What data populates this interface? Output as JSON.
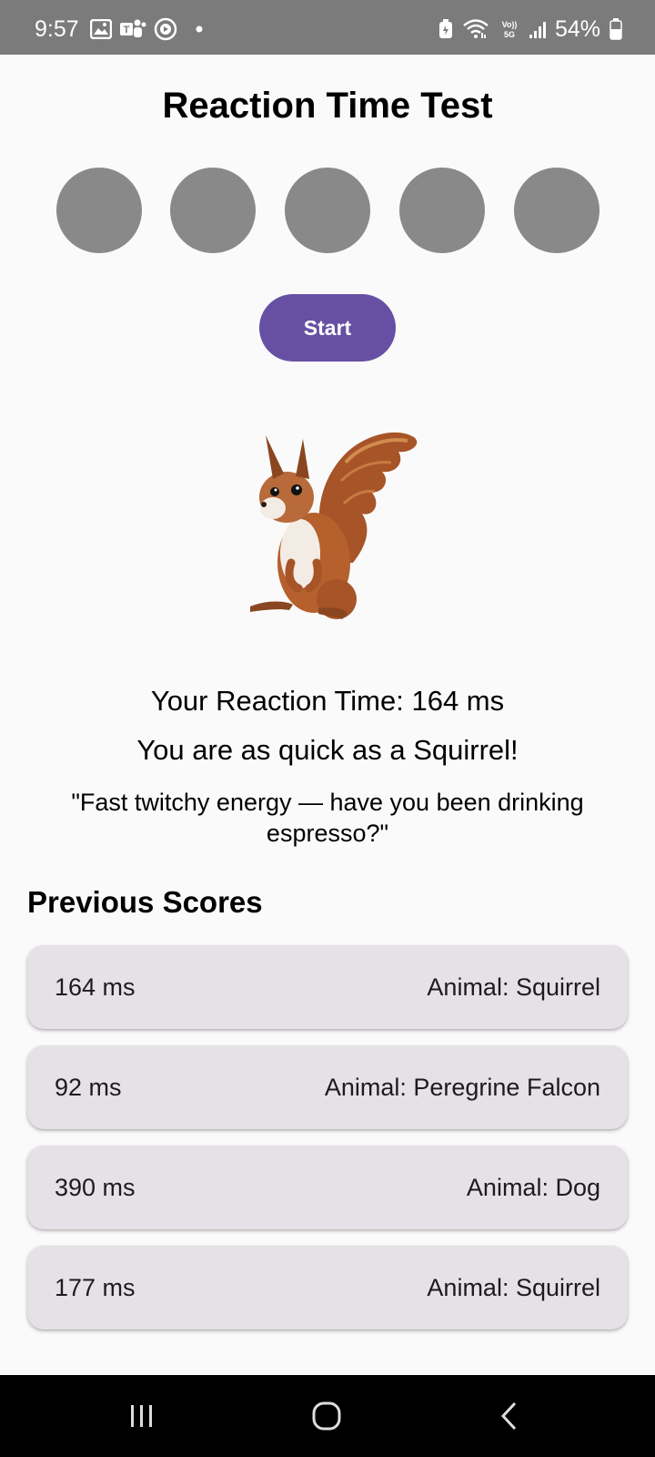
{
  "status_bar": {
    "time": "9:57",
    "battery_percent": "54%",
    "left_icons": [
      "gallery-icon",
      "teams-icon",
      "media-icon",
      "dot-icon"
    ],
    "right_icons": [
      "battery-saver-icon",
      "wifi-icon",
      "volte-5g-icon",
      "signal-icon",
      "battery-icon"
    ]
  },
  "app": {
    "title": "Reaction Time Test",
    "lights": [
      {
        "color": "#898989"
      },
      {
        "color": "#898989"
      },
      {
        "color": "#898989"
      },
      {
        "color": "#898989"
      },
      {
        "color": "#898989"
      }
    ],
    "start_label": "Start",
    "animal_image": "squirrel",
    "reaction_time": "Your Reaction Time: 164 ms",
    "comparison": "You are as quick as a Squirrel!",
    "quote": "\"Fast twitchy energy — have you been drinking espresso?\""
  },
  "previous_scores": {
    "title": "Previous Scores",
    "items": [
      {
        "time": "164 ms",
        "animal": "Animal: Squirrel"
      },
      {
        "time": "92 ms",
        "animal": "Animal: Peregrine Falcon"
      },
      {
        "time": "390 ms",
        "animal": "Animal: Dog"
      },
      {
        "time": "177 ms",
        "animal": "Animal: Squirrel"
      }
    ]
  },
  "nav_bar": {
    "buttons": [
      "recents-icon",
      "home-icon",
      "back-icon"
    ]
  },
  "colors": {
    "accent": "#6750a4",
    "light_off": "#898989",
    "card_bg": "#e6e1e7",
    "status_bar_bg": "#7b7b7b"
  }
}
